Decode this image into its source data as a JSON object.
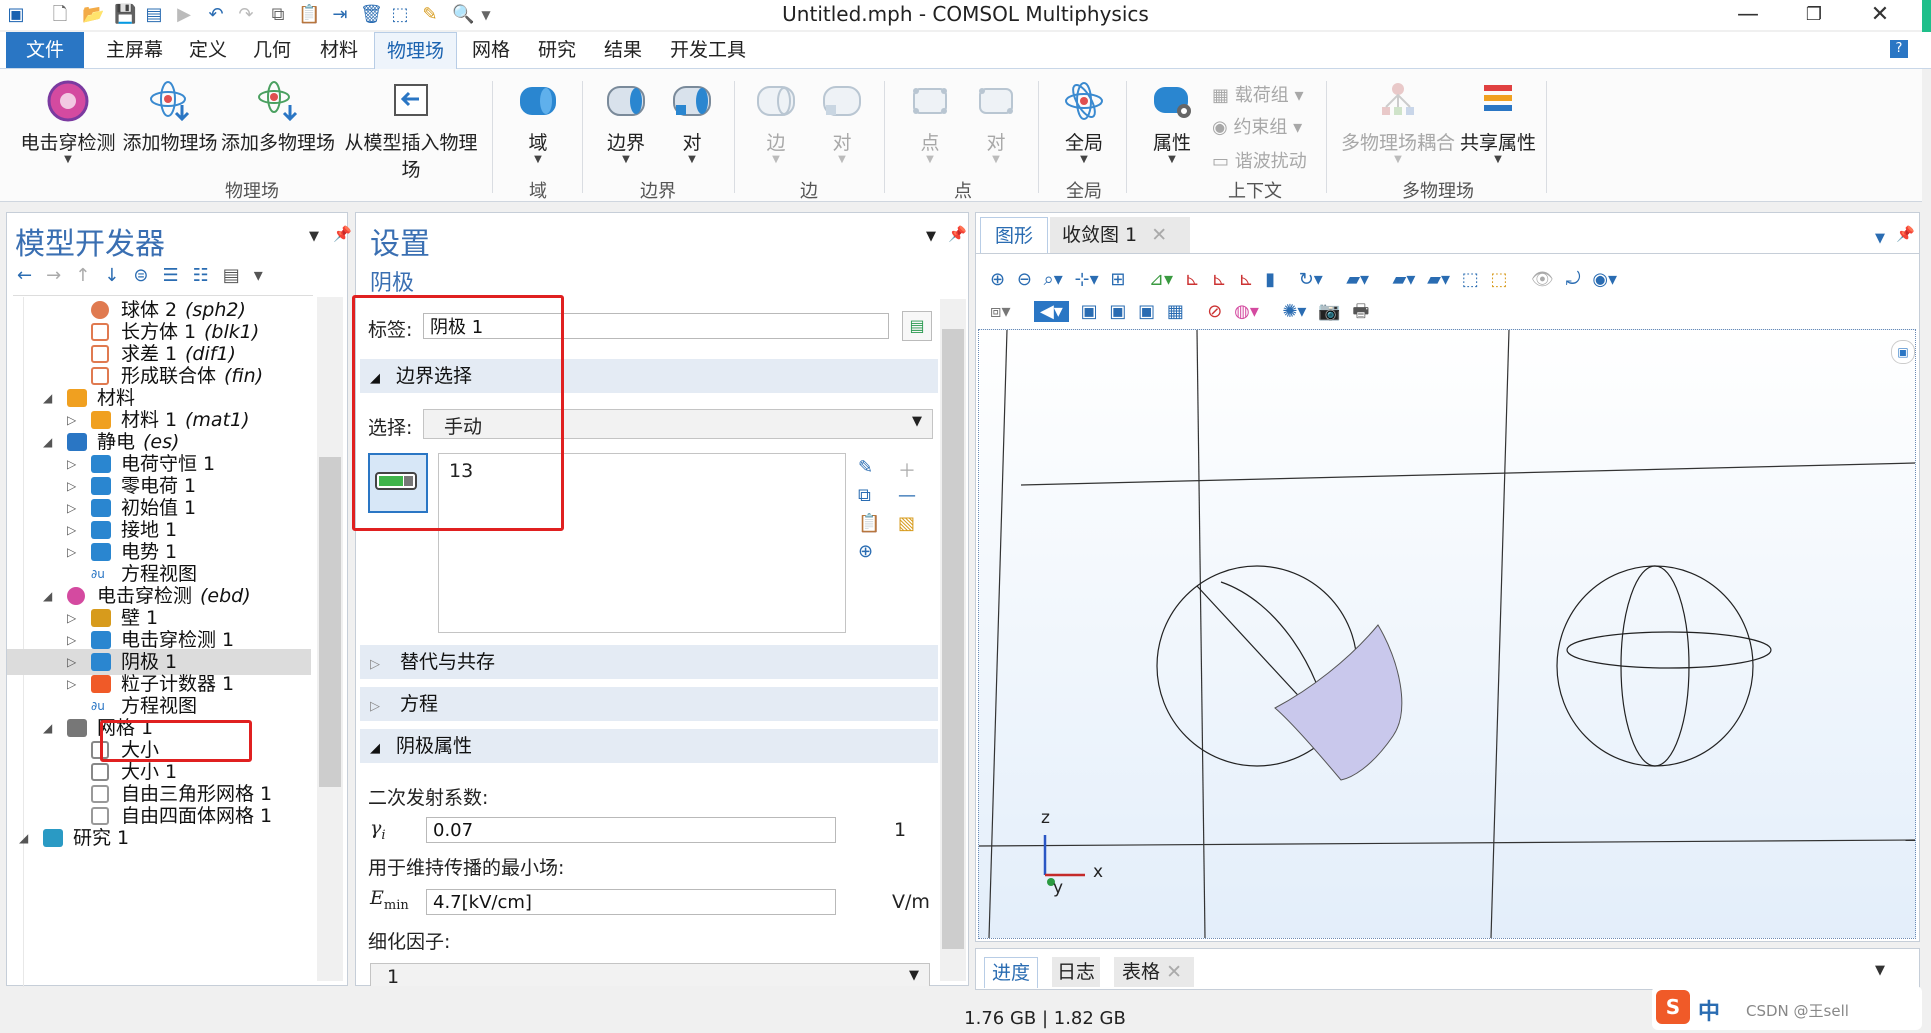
{
  "window": {
    "title": "Untitled.mph - COMSOL Multiphysics",
    "minimize": "—",
    "maximize": "❐",
    "close": "✕"
  },
  "menu_tabs": [
    "文件",
    "主屏幕",
    "定义",
    "几何",
    "材料",
    "物理场",
    "网格",
    "研究",
    "结果",
    "开发工具"
  ],
  "help_label": "?",
  "ribbon": {
    "physics_group": {
      "label": "物理场",
      "buttons": [
        "电击穿检测",
        "添加物理场",
        "添加多物理场",
        "从模型插入物理场"
      ]
    },
    "domain_group": {
      "label": "域",
      "buttons": [
        "域"
      ]
    },
    "boundary_group": {
      "label": "边界",
      "buttons": [
        "边界",
        "对"
      ]
    },
    "edge_group": {
      "label": "边",
      "buttons": [
        "边",
        "对"
      ]
    },
    "point_group": {
      "label": "点",
      "buttons": [
        "点",
        "对"
      ]
    },
    "global_group": {
      "label": "全局",
      "buttons": [
        "全局"
      ]
    },
    "context_group": {
      "label": "上下文",
      "buttons": [
        "属性"
      ],
      "small_items": [
        "载荷组",
        "约束组",
        "谐波扰动"
      ]
    },
    "multiphysics_group": {
      "label": "多物理场",
      "buttons": [
        "多物理场耦合",
        "共享属性"
      ]
    }
  },
  "model_builder": {
    "title": "模型开发器",
    "tree": [
      {
        "label": "球体 2",
        "tag": "(sph2)",
        "icon": "sphere-icon"
      },
      {
        "label": "长方体 1",
        "tag": "(blk1)",
        "icon": "block-icon"
      },
      {
        "label": "求差 1",
        "tag": "(dif1)",
        "icon": "difference-icon"
      },
      {
        "label": "形成联合体",
        "tag": "(fin)",
        "icon": "union-icon"
      },
      {
        "label": "材料",
        "tag": "",
        "icon": "materials-icon"
      },
      {
        "label": "材料 1",
        "tag": "(mat1)",
        "icon": "material-icon"
      },
      {
        "label": "静电",
        "tag": "(es)",
        "icon": "electrostatics-icon"
      },
      {
        "label": "电荷守恒 1",
        "tag": "",
        "icon": "domain-node-icon"
      },
      {
        "label": "零电荷 1",
        "tag": "",
        "icon": "boundary-node-icon"
      },
      {
        "label": "初始值 1",
        "tag": "",
        "icon": "domain-node-icon"
      },
      {
        "label": "接地 1",
        "tag": "",
        "icon": "boundary-node-icon"
      },
      {
        "label": "电势 1",
        "tag": "",
        "icon": "boundary-node-icon"
      },
      {
        "label": "方程视图",
        "tag": "",
        "icon": "equation-icon"
      },
      {
        "label": "电击穿检测",
        "tag": "(ebd)",
        "icon": "breakdown-icon"
      },
      {
        "label": "壁 1",
        "tag": "",
        "icon": "wall-icon"
      },
      {
        "label": "电击穿检测 1",
        "tag": "",
        "icon": "domain-node-icon"
      },
      {
        "label": "阴极 1",
        "tag": "",
        "icon": "boundary-node-icon"
      },
      {
        "label": "粒子计数器 1",
        "tag": "",
        "icon": "counter-icon"
      },
      {
        "label": "方程视图",
        "tag": "",
        "icon": "equation-icon"
      },
      {
        "label": "网格 1",
        "tag": "",
        "icon": "mesh-icon"
      },
      {
        "label": "大小",
        "tag": "",
        "icon": "size-icon"
      },
      {
        "label": "大小 1",
        "tag": "",
        "icon": "size-icon"
      },
      {
        "label": "自由三角形网格 1",
        "tag": "",
        "icon": "tri-mesh-icon"
      },
      {
        "label": "自由四面体网格 1",
        "tag": "",
        "icon": "tet-mesh-icon"
      },
      {
        "label": "研究 1",
        "tag": "",
        "icon": "study-icon"
      }
    ]
  },
  "settings": {
    "title": "设置",
    "subtitle": "阴极",
    "label_caption": "标签:",
    "label_value": "阴极 1",
    "boundary_section": "边界选择",
    "selection_caption": "选择:",
    "selection_value": "手动",
    "selection_list": [
      "13"
    ],
    "sections_collapsed": [
      "替代与共存",
      "方程"
    ],
    "cathode_section": "阴极属性",
    "secondary_caption": "二次发射系数:",
    "gamma_symbol": "γ",
    "gamma_sub": "i",
    "gamma_value": "0.07",
    "gamma_unit": "1",
    "min_field_caption": "用于维持传播的最小场:",
    "emin_symbol": "E",
    "emin_sub": "min",
    "emin_value": "4.7[kV/cm]",
    "emin_unit": "V/m",
    "refine_caption": "细化因子:",
    "refine_value": "1"
  },
  "graphics": {
    "tabs": [
      "图形",
      "收敛图 1"
    ],
    "axes": {
      "z": "z",
      "y": "y",
      "x": "x"
    }
  },
  "bottom_tabs": [
    "进度",
    "日志",
    "表格"
  ],
  "status": {
    "memory": "1.76 GB | 1.82 GB"
  },
  "ime": {
    "label": "中",
    "watermark": "CSDN @王sell"
  },
  "colors": {
    "accent": "#2a76c4",
    "tab_text": "#1a62b0",
    "highlight_box": "#e02020",
    "graphics_bg": "#e8f1fb"
  }
}
